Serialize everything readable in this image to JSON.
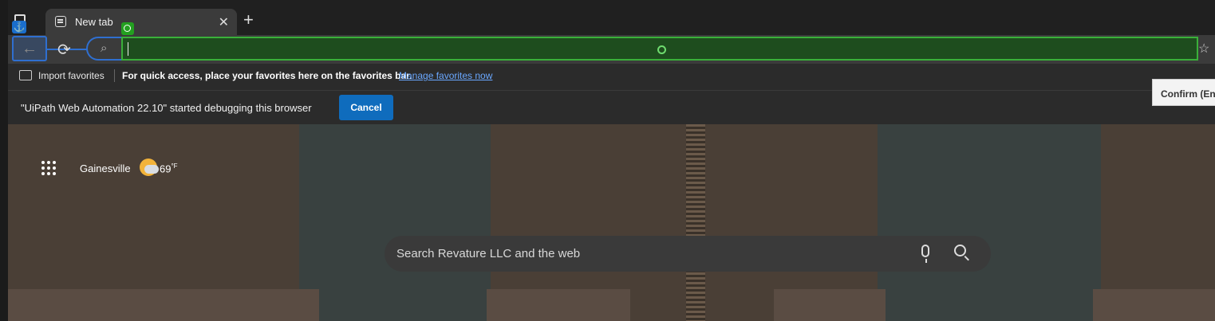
{
  "tab": {
    "title": "New tab",
    "close": "✕",
    "new": "+"
  },
  "toolbar": {
    "back": "←",
    "refresh": "⟳",
    "search_glyph": "⌕",
    "address_value": "",
    "star": "☆",
    "anchor": "⚓"
  },
  "favorites_bar": {
    "import_label": "Import favorites",
    "quick_access_text": "For quick access, place your favorites here on the favorites bar.",
    "manage_link": "Manage favorites now"
  },
  "tooltip": {
    "text": "Confirm (Ent"
  },
  "infobar": {
    "message": "\"UiPath Web Automation 22.10\" started debugging this browser",
    "cancel_label": "Cancel"
  },
  "weather": {
    "city": "Gainesville",
    "temp": "69",
    "unit": "°F"
  },
  "newtab_search": {
    "placeholder": "Search Revature LLC and the web"
  },
  "colors": {
    "accent": "#0f6cbd",
    "selection_green": "#3ab03a",
    "selection_blue": "#2f6fd0"
  }
}
